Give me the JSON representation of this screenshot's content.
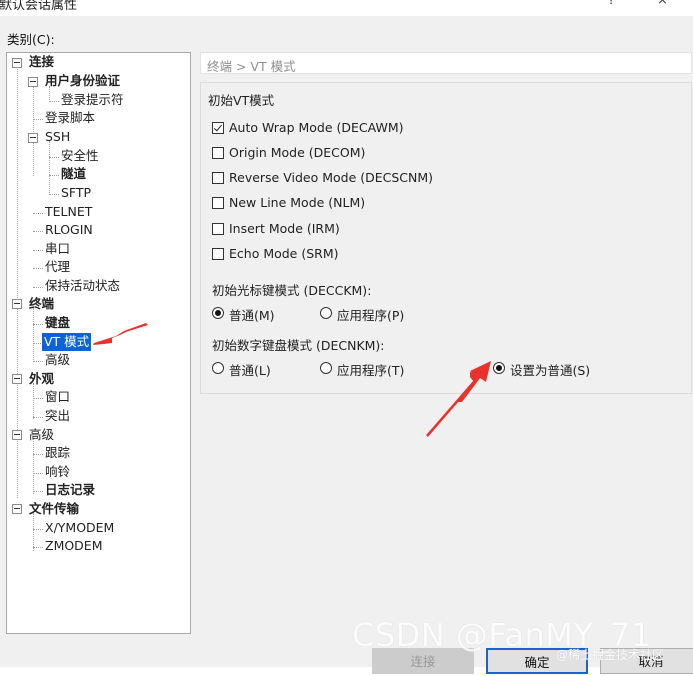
{
  "window": {
    "title": "默认会话属性",
    "help_label": "?",
    "close_label": "×"
  },
  "category_label": "类别(C):",
  "tree": {
    "items": [
      {
        "label": "连接",
        "bold": true
      },
      {
        "label": "用户身份验证",
        "bold": true
      },
      {
        "label": "登录提示符",
        "bold": false
      },
      {
        "label": "登录脚本",
        "bold": false
      },
      {
        "label": "SSH",
        "bold": false
      },
      {
        "label": "安全性",
        "bold": false
      },
      {
        "label": "隧道",
        "bold": true
      },
      {
        "label": "SFTP",
        "bold": false
      },
      {
        "label": "TELNET",
        "bold": false
      },
      {
        "label": "RLOGIN",
        "bold": false
      },
      {
        "label": "串口",
        "bold": false
      },
      {
        "label": "代理",
        "bold": false
      },
      {
        "label": "保持活动状态",
        "bold": false
      },
      {
        "label": "终端",
        "bold": true
      },
      {
        "label": "键盘",
        "bold": true
      },
      {
        "label": "VT 模式",
        "bold": false,
        "selected": true
      },
      {
        "label": "高级",
        "bold": false
      },
      {
        "label": "外观",
        "bold": true
      },
      {
        "label": "窗口",
        "bold": false
      },
      {
        "label": "突出",
        "bold": false
      },
      {
        "label": "高级",
        "bold": false
      },
      {
        "label": "跟踪",
        "bold": false
      },
      {
        "label": "响铃",
        "bold": false
      },
      {
        "label": "日志记录",
        "bold": true
      },
      {
        "label": "文件传输",
        "bold": true
      },
      {
        "label": "X/YMODEM",
        "bold": false
      },
      {
        "label": "ZMODEM",
        "bold": false
      }
    ]
  },
  "breadcrumb": "终端 > VT 模式",
  "initial_vt_mode": {
    "title": "初始VT模式",
    "options": [
      {
        "label": "Auto Wrap Mode (DECAWM)",
        "checked": true
      },
      {
        "label": "Origin Mode (DECOM)",
        "checked": false
      },
      {
        "label": "Reverse Video Mode (DECSCNM)",
        "checked": false
      },
      {
        "label": "New Line Mode (NLM)",
        "checked": false
      },
      {
        "label": "Insert Mode (IRM)",
        "checked": false
      },
      {
        "label": "Echo Mode (SRM)",
        "checked": false
      }
    ]
  },
  "cursor_key_mode": {
    "title": "初始光标键模式 (DECCKM):",
    "options": [
      {
        "label": "普通(M)",
        "selected": true
      },
      {
        "label": "应用程序(P)",
        "selected": false
      }
    ]
  },
  "keypad_mode": {
    "title": "初始数字键盘模式 (DECNKM):",
    "options": [
      {
        "label": "普通(L)",
        "selected": false
      },
      {
        "label": "应用程序(T)",
        "selected": false
      },
      {
        "label": "设置为普通(S)",
        "selected": true
      }
    ]
  },
  "buttons": {
    "connect": "连接",
    "ok": "确定",
    "cancel": "取消"
  },
  "watermark": {
    "main": "CSDN @FanMY_71",
    "secondary": "@稀土掘金技术社区"
  },
  "colors": {
    "selection": "#0a64d6",
    "arrow": "#e8322c",
    "dialog_bg": "#f0f0f0"
  }
}
